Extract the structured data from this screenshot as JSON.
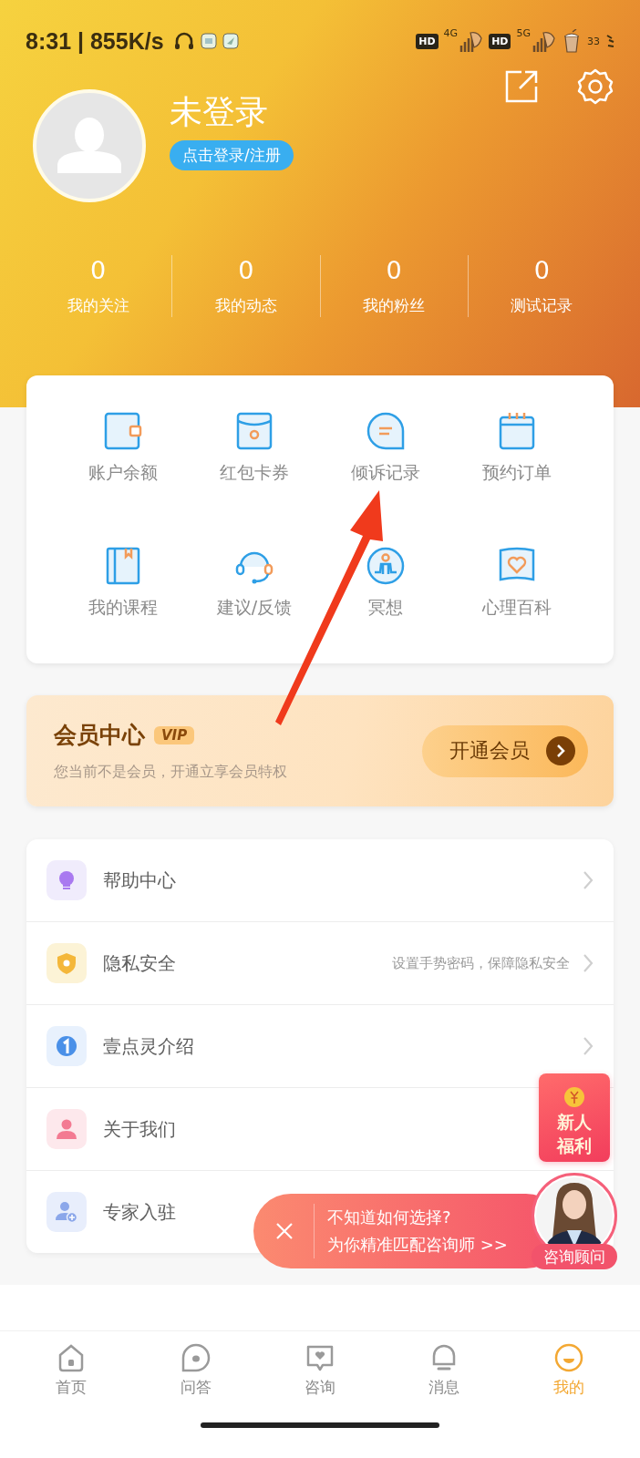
{
  "status_bar": {
    "time": "8:31 | 855K/s",
    "sim1_badge": "HD",
    "sim1_network": "4G",
    "sim2_badge": "HD",
    "sim2_network": "5G",
    "battery": "33"
  },
  "profile": {
    "name": "未登录",
    "login_button": "点击登录/注册"
  },
  "stats": [
    {
      "value": "0",
      "label": "我的关注"
    },
    {
      "value": "0",
      "label": "我的动态"
    },
    {
      "value": "0",
      "label": "我的粉丝"
    },
    {
      "value": "0",
      "label": "测试记录"
    }
  ],
  "shortcuts": [
    {
      "kind": "wallet",
      "label": "账户余额"
    },
    {
      "kind": "envelope",
      "label": "红包卡券"
    },
    {
      "kind": "chat",
      "label": "倾诉记录"
    },
    {
      "kind": "calendar",
      "label": "预约订单"
    },
    {
      "kind": "book",
      "label": "我的课程"
    },
    {
      "kind": "headset",
      "label": "建议/反馈"
    },
    {
      "kind": "meditate",
      "label": "冥想"
    },
    {
      "kind": "heartbook",
      "label": "心理百科"
    }
  ],
  "vip": {
    "title": "会员中心",
    "badge": "VIP",
    "subtitle": "您当前不是会员，开通立享会员特权",
    "button": "开通会员"
  },
  "menu": [
    {
      "kind": "bulb",
      "label": "帮助中心",
      "color": "#f0ecfc",
      "chevron": true
    },
    {
      "kind": "shield",
      "label": "隐私安全",
      "hint": "设置手势密码，保障隐私安全",
      "color": "#fcf3d6",
      "chevron": true
    },
    {
      "kind": "one",
      "label": "壹点灵介绍",
      "color": "#e8f1fd",
      "chevron": true
    },
    {
      "kind": "person",
      "label": "关于我们",
      "color": "#fde8ec",
      "chevron": false
    },
    {
      "kind": "personadd",
      "label": "专家入驻",
      "color": "#e8eefc",
      "chevron": false
    }
  ],
  "new_user_gift": {
    "label": "新人福利"
  },
  "consult_banner": {
    "line1": "不知道如何选择?",
    "line2": "为你精准匹配咨询师 >>",
    "badge": "咨询顾问"
  },
  "tabs": [
    {
      "kind": "home",
      "label": "首页",
      "selected": false
    },
    {
      "kind": "qa",
      "label": "问答",
      "selected": false
    },
    {
      "kind": "consult",
      "label": "咨询",
      "selected": false
    },
    {
      "kind": "bell",
      "label": "消息",
      "selected": false
    },
    {
      "kind": "me",
      "label": "我的",
      "selected": true
    }
  ]
}
